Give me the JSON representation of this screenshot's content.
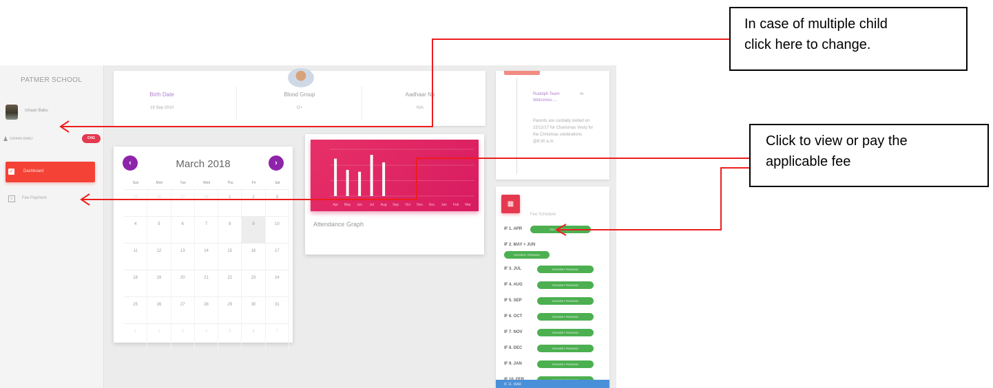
{
  "sidebar": {
    "school_name": "PATMER SCHOOL",
    "user_name": "Ishaan Babu",
    "child_name": "ISHAAN BABU",
    "change_label": "CHG",
    "nav": {
      "dashboard": "Dashboard",
      "fee_payment": "Fee Payment"
    }
  },
  "student_info": {
    "birth_date_label": "Birth Date",
    "birth_date_value": "19 Sep 2010",
    "blood_group_label": "Blood Group",
    "blood_group_value": "O+",
    "aadhaar_label": "Aadhaar No",
    "aadhaar_value": "N/A"
  },
  "calendar": {
    "title": "March 2018",
    "weekdays": [
      "Sun",
      "Mon",
      "Tue",
      "Wed",
      "Thu",
      "Fri",
      "Sat"
    ],
    "weeks": [
      [
        "25",
        "26",
        "27",
        "28",
        "1",
        "2",
        "3"
      ],
      [
        "4",
        "5",
        "6",
        "7",
        "8",
        "9",
        "10"
      ],
      [
        "11",
        "12",
        "13",
        "14",
        "15",
        "16",
        "17"
      ],
      [
        "18",
        "19",
        "20",
        "21",
        "22",
        "23",
        "24"
      ],
      [
        "25",
        "26",
        "27",
        "28",
        "29",
        "30",
        "31"
      ],
      [
        "1",
        "2",
        "3",
        "4",
        "5",
        "6",
        "7"
      ]
    ],
    "today": "9"
  },
  "attendance": {
    "title": "Attendance Graph",
    "chart_data": {
      "type": "bar",
      "categories": [
        "Apr",
        "May",
        "Jun",
        "Jul",
        "Aug",
        "Sep",
        "Oct",
        "Nov",
        "Dec",
        "Jan",
        "Feb",
        "Mar"
      ],
      "values": [
        20,
        14,
        13,
        22,
        18,
        0,
        0,
        0,
        0,
        0,
        0,
        0
      ],
      "ylim": [
        0,
        25
      ],
      "bar_color": "#ffffff",
      "background": "#e0306a"
    }
  },
  "notice": {
    "title": "Rudolph Team Welcomes ...",
    "time": "4h",
    "body": "Parents are cordially invited on 22/12/17 for Charismas Vesty for the Christmas celebrations @8:30 a.m."
  },
  "fees": {
    "heading": "Fee Schedule",
    "items": [
      {
        "label": "IF 1. APR",
        "status": "PAYMENT DONE"
      },
      {
        "label": "IF 2. MAY + JUN",
        "status": "PAYMENT PENDING"
      },
      {
        "label": "IF 3. JUL",
        "status": "PAYMENT PENDING"
      },
      {
        "label": "IF 4. AUG",
        "status": "PAYMENT PENDING"
      },
      {
        "label": "IF 5. SEP",
        "status": "PAYMENT PENDING"
      },
      {
        "label": "IF 6. OCT",
        "status": "PAYMENT PENDING"
      },
      {
        "label": "IF 7. NOV",
        "status": "PAYMENT PENDING"
      },
      {
        "label": "IF 8. DEC",
        "status": "PAYMENT PENDING"
      },
      {
        "label": "IF 9. JAN",
        "status": "PAYMENT PENDING"
      },
      {
        "label": "IF 10. FEB",
        "status": "PAYMENT PENDING"
      }
    ],
    "last_label": "IF 11. MAR"
  },
  "callouts": {
    "multiple_child": [
      "In case of multiple child",
      "click here to change."
    ],
    "fee": [
      "Click to view or pay the",
      "applicable fee"
    ]
  },
  "colors": {
    "accent_red": "#f44336",
    "accent_purple": "#8e24aa",
    "graph_pink": "#e0306a",
    "fee_green": "#4caf50",
    "arrow_red": "#ee1c1c"
  }
}
